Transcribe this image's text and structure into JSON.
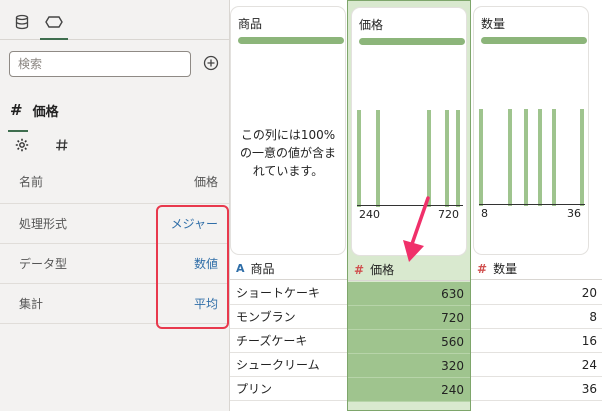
{
  "search": {
    "placeholder": "検索"
  },
  "column": {
    "type_symbol": "#",
    "name": "価格"
  },
  "properties": [
    {
      "key": "名前",
      "value": "価格"
    },
    {
      "key": "処理形式",
      "value": "メジャー"
    },
    {
      "key": "データ型",
      "value": "数値"
    },
    {
      "key": "集計",
      "value": "平均"
    }
  ],
  "columns": [
    {
      "name": "商品",
      "type": "A",
      "message": "この列には100%の一意の値が含まれています。",
      "rows": [
        "ショートケーキ",
        "モンブラン",
        "チーズケーキ",
        "シュークリーム",
        "プリン"
      ]
    },
    {
      "name": "価格",
      "type": "#",
      "hist_min": "240",
      "hist_max": "720",
      "rows": [
        "630",
        "720",
        "560",
        "320",
        "240"
      ]
    },
    {
      "name": "数量",
      "type": "#",
      "hist_min": "8",
      "hist_max": "36",
      "rows": [
        "20",
        "8",
        "16",
        "24",
        "36"
      ]
    }
  ],
  "colors": {
    "accent": "#3f6e4f",
    "bar": "#8cb57a",
    "selected": "#9fc48e",
    "highlight": "#e8394d"
  }
}
